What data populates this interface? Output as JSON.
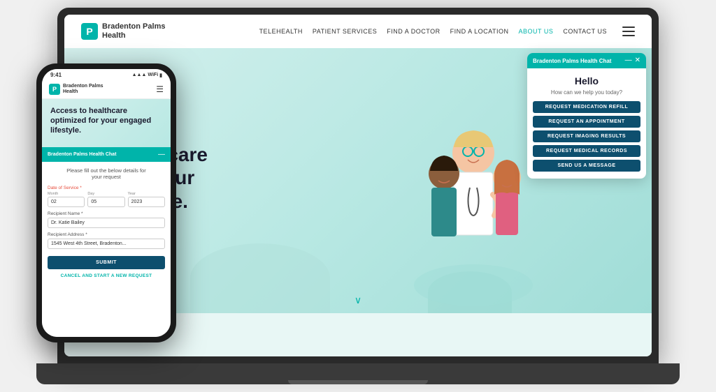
{
  "laptop": {
    "nav": {
      "logo_text_line1": "Bradenton Palms",
      "logo_text_line2": "Health",
      "logo_letter": "P",
      "links": [
        {
          "label": "TELEHEALTH",
          "active": false
        },
        {
          "label": "PATIENT SERVICES",
          "active": false
        },
        {
          "label": "FIND A DOCTOR",
          "active": false
        },
        {
          "label": "FIND A LOCATION",
          "active": false
        },
        {
          "label": "ABOUT US",
          "active": true
        },
        {
          "label": "CONTACT US",
          "active": false
        }
      ]
    },
    "hero": {
      "title_line1": "o healthcare",
      "title_line2": "ed for your",
      "title_line3": "d lifestyle."
    },
    "chat": {
      "header_title": "Bradenton Palms Health Chat",
      "hello": "Hello",
      "subtitle": "How can we help you today?",
      "buttons": [
        "REQUEST MEDICATION REFILL",
        "REQUEST AN APPOINTMENT",
        "REQUEST IMAGING RESULTS",
        "REQUEST MEDICAL RECORDS",
        "SEND US A MESSAGE"
      ],
      "minimize_icon": "—",
      "close_icon": "✕"
    }
  },
  "phone": {
    "status_bar": {
      "time": "9:41",
      "wifi": "WiFi",
      "signal": "Signal",
      "battery": "Battery"
    },
    "nav": {
      "logo_letter": "P",
      "logo_text_line1": "Bradenton Palms",
      "logo_text_line2": "Health"
    },
    "hero": {
      "title": "Access to healthcare optimized for your engaged lifestyle."
    },
    "chat": {
      "header_title": "Bradenton Palms Health Chat",
      "minimize_icon": "—",
      "form_subtitle_line1": "Please fill out the below details for",
      "form_subtitle_line2": "your request",
      "date_label": "Date of Service *",
      "month_label": "Month",
      "day_label": "Day",
      "year_label": "Year",
      "month_value": "02",
      "day_value": "05",
      "year_value": "2023",
      "recipient_name_label": "Recipient Name *",
      "recipient_name_value": "Dr. Katie Bailey",
      "recipient_address_label": "Recipient Address *",
      "recipient_address_value": "1545 West 4th Street, Bradenton...",
      "submit_label": "SUBMIT",
      "cancel_label": "CANCEL AND START A NEW REQUEST"
    }
  }
}
